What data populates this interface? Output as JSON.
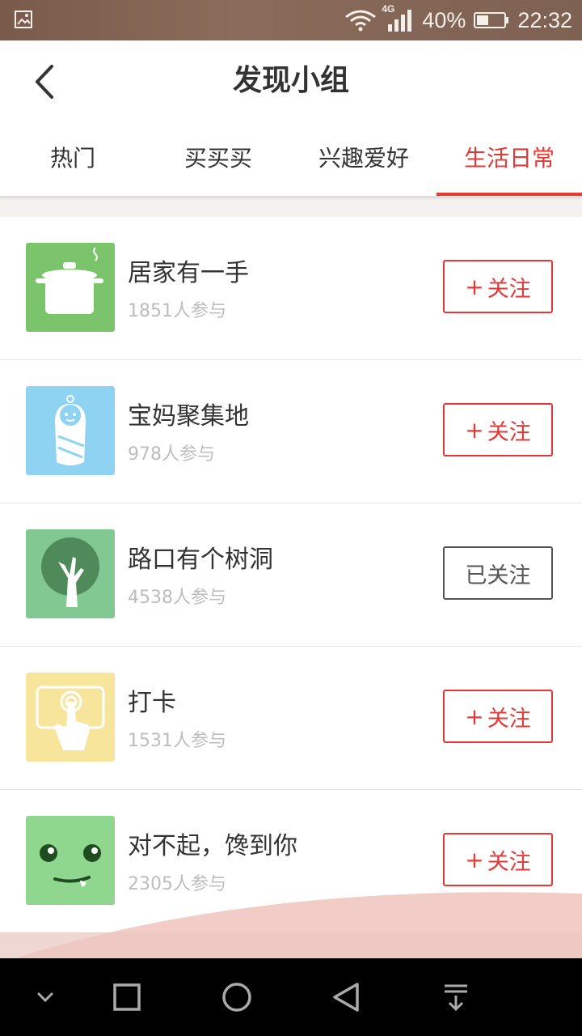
{
  "status_bar": {
    "battery": "40%",
    "time": "22:32",
    "network": "4G"
  },
  "header": {
    "title": "发现小组"
  },
  "tabs": [
    {
      "label": "热门",
      "active": false
    },
    {
      "label": "买买买",
      "active": false
    },
    {
      "label": "兴趣爱好",
      "active": false
    },
    {
      "label": "生活日常",
      "active": true
    }
  ],
  "groups": [
    {
      "name": "居家有一手",
      "count": "1851人参与",
      "followed": false,
      "button": "关注",
      "button_prefix": "+",
      "icon": "pot-icon",
      "icon_color": "#7cc46b"
    },
    {
      "name": "宝妈聚集地",
      "count": "978人参与",
      "followed": false,
      "button": "关注",
      "button_prefix": "+",
      "icon": "baby-icon",
      "icon_color": "#8fd3f2"
    },
    {
      "name": "路口有个树洞",
      "count": "4538人参与",
      "followed": true,
      "button": "已关注",
      "button_prefix": "",
      "icon": "tree-icon",
      "icon_color": "#82c893"
    },
    {
      "name": "打卡",
      "count": "1531人参与",
      "followed": false,
      "button": "关注",
      "button_prefix": "+",
      "icon": "tap-icon",
      "icon_color": "#f7e59c"
    },
    {
      "name": "对不起，馋到你",
      "count": "2305人参与",
      "followed": false,
      "button": "关注",
      "button_prefix": "+",
      "icon": "drool-face-icon",
      "icon_color": "#8fd68f"
    }
  ],
  "colors": {
    "accent": "#e53935",
    "followed_border": "#555555"
  }
}
